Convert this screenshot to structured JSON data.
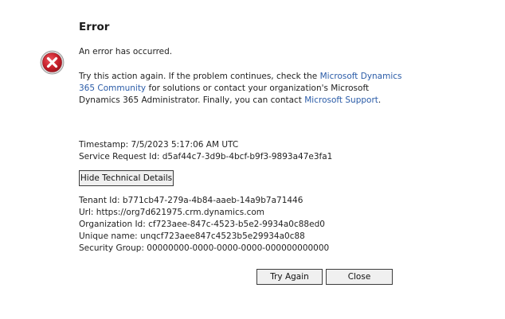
{
  "dialog": {
    "title": "Error",
    "subtitle": "An error has occurred.",
    "message": {
      "part1": "Try this action again. If the problem continues, check the ",
      "link1_line1": "Microsoft Dynamics",
      "link1_line2": "365 Community",
      "part2": " for solutions or contact your organization's Microsoft",
      "part3": "Dynamics 365 Administrator. Finally, you can contact ",
      "link2": "Microsoft Support",
      "part4": "."
    },
    "timestamp": "Timestamp: 7/5/2023 5:17:06 AM UTC",
    "service_request_id": "Service Request Id: d5af44c7-3d9b-4bcf-b9f3-9893a47e3fa1",
    "hide_details_label": "Hide Technical Details",
    "details": {
      "tenant_id": "Tenant Id: b771cb47-279a-4b84-aaeb-14a9b7a71446",
      "url": "Url: https://org7d621975.crm.dynamics.com",
      "organization_id": "Organization Id: cf723aee-847c-4523-b5e2-9934a0c88ed0",
      "unique_name": "Unique name: unqcf723aee847c4523b5e29934a0c88",
      "security_group": "Security Group: 00000000-0000-0000-0000-000000000000"
    },
    "try_again_label": "Try Again",
    "close_label": "Close"
  },
  "icons": {
    "error": "error-x-circle-icon"
  },
  "colors": {
    "error_red": "#c8202b",
    "link_blue": "#2b5ca8",
    "button_bg": "#f0f0f0"
  }
}
